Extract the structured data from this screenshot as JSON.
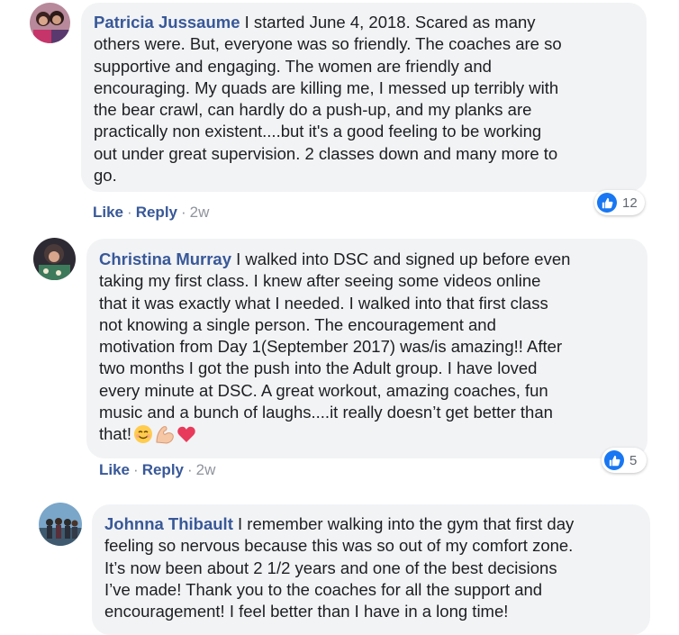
{
  "comments": [
    {
      "author": "Patricia Jussaume",
      "text": "I started June 4, 2018. Scared as many\nothers were. But, everyone was so friendly. The coaches are so\nsupportive and engaging. The women are friendly and\nencouraging. My quads are killing me, I messed up terribly with\nthe bear crawl, can hardly do a push-up, and my planks are\npractically non existent....but it's a good feeling to be working\nout under great supervision. 2 classes down and many more to\ngo.",
      "like_label": "Like",
      "reply_label": "Reply",
      "time": "2w",
      "reaction_count": "12"
    },
    {
      "author": "Christina Murray",
      "text": "I walked into DSC and signed up before even\ntaking my first class. I knew after seeing some videos online\nthat it was exactly what I needed. I walked into that first class\nnot knowing a single person. The encouragement and\nmotivation from Day 1(September 2017) was/is amazing!! After\ntwo months I got the push into the Adult group. I have loved\nevery minute at DSC. A great workout, amazing coaches, fun\nmusic and a bunch of laughs....it really doesn’t get better than\nthat!",
      "like_label": "Like",
      "reply_label": "Reply",
      "time": "2w",
      "reaction_count": "5",
      "emojis": [
        "smiling-face-emoji",
        "flexed-biceps-emoji",
        "red-heart-emoji"
      ]
    },
    {
      "author": "Johnna Thibault",
      "text": "I remember walking into the gym that first day\nfeeling so nervous because this was so out of my comfort zone.\nIt’s now been about 2 1/2 years and one of the best decisions\nI’ve made! Thank you to the coaches for all the support and\nencouragement! I feel better than I have in a long time!"
    }
  ],
  "separator": "·",
  "colors": {
    "link": "#385898",
    "bubble": "#f2f3f5",
    "like_blue": "#1877f2",
    "meta_gray": "#90949c"
  }
}
